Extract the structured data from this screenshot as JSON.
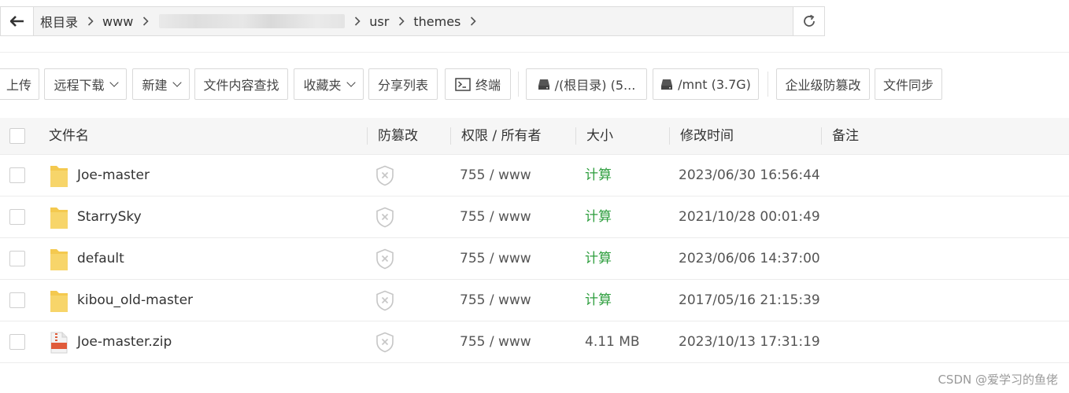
{
  "breadcrumb": {
    "items": [
      "根目录",
      "www",
      "usr",
      "themes"
    ]
  },
  "toolbar": {
    "upload": "上传",
    "remote_download": "远程下载",
    "new": "新建",
    "search_content": "文件内容查找",
    "favorites": "收藏夹",
    "share_list": "分享列表",
    "terminal": "终端",
    "disk_root": "/(根目录) (5...",
    "disk_mnt": "/mnt (3.7G)",
    "enterprise_tamper": "企业级防篡改",
    "file_sync": "文件同步"
  },
  "table": {
    "headers": {
      "name": "文件名",
      "tamper": "防篡改",
      "perm": "权限 / 所有者",
      "size": "大小",
      "mtime": "修改时间",
      "note": "备注"
    },
    "rows": [
      {
        "type": "folder",
        "name": "Joe-master",
        "perm": "755 / www",
        "size": "计算",
        "mtime": "2023/06/30 16:56:44"
      },
      {
        "type": "folder",
        "name": "StarrySky",
        "perm": "755 / www",
        "size": "计算",
        "mtime": "2021/10/28 00:01:49"
      },
      {
        "type": "folder",
        "name": "default",
        "perm": "755 / www",
        "size": "计算",
        "mtime": "2023/06/06 14:37:00"
      },
      {
        "type": "folder",
        "name": "kibou_old-master",
        "perm": "755 / www",
        "size": "计算",
        "mtime": "2017/05/16 21:15:39"
      },
      {
        "type": "zip",
        "name": "Joe-master.zip",
        "perm": "755 / www",
        "size": "4.11 MB",
        "mtime": "2023/10/13 17:31:19"
      }
    ]
  },
  "watermark": "CSDN @爱学习的鱼佬",
  "colors": {
    "calc_green": "#2e9e3e",
    "folder_yellow": "#f4c94f",
    "zip_red": "#e05b3a"
  }
}
